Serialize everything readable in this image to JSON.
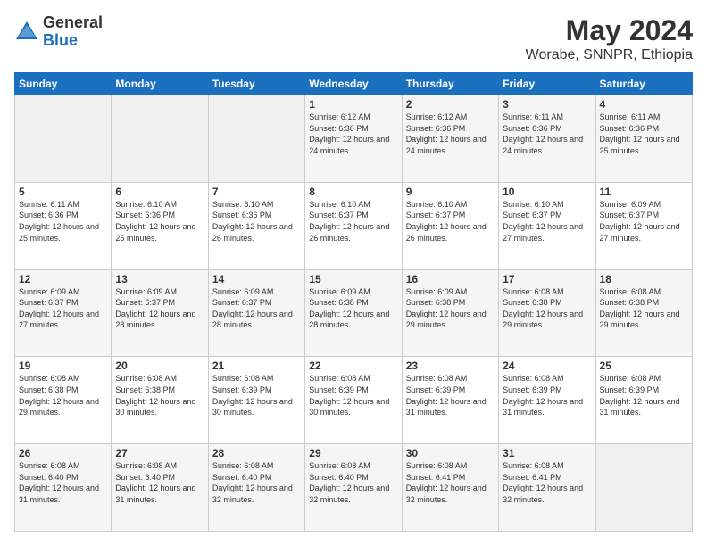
{
  "header": {
    "logo_general": "General",
    "logo_blue": "Blue",
    "month_year": "May 2024",
    "location": "Worabe, SNNPR, Ethiopia"
  },
  "weekdays": [
    "Sunday",
    "Monday",
    "Tuesday",
    "Wednesday",
    "Thursday",
    "Friday",
    "Saturday"
  ],
  "weeks": [
    [
      {
        "day": "",
        "info": ""
      },
      {
        "day": "",
        "info": ""
      },
      {
        "day": "",
        "info": ""
      },
      {
        "day": "1",
        "info": "Sunrise: 6:12 AM\nSunset: 6:36 PM\nDaylight: 12 hours and 24 minutes."
      },
      {
        "day": "2",
        "info": "Sunrise: 6:12 AM\nSunset: 6:36 PM\nDaylight: 12 hours and 24 minutes."
      },
      {
        "day": "3",
        "info": "Sunrise: 6:11 AM\nSunset: 6:36 PM\nDaylight: 12 hours and 24 minutes."
      },
      {
        "day": "4",
        "info": "Sunrise: 6:11 AM\nSunset: 6:36 PM\nDaylight: 12 hours and 25 minutes."
      }
    ],
    [
      {
        "day": "5",
        "info": "Sunrise: 6:11 AM\nSunset: 6:36 PM\nDaylight: 12 hours and 25 minutes."
      },
      {
        "day": "6",
        "info": "Sunrise: 6:10 AM\nSunset: 6:36 PM\nDaylight: 12 hours and 25 minutes."
      },
      {
        "day": "7",
        "info": "Sunrise: 6:10 AM\nSunset: 6:36 PM\nDaylight: 12 hours and 26 minutes."
      },
      {
        "day": "8",
        "info": "Sunrise: 6:10 AM\nSunset: 6:37 PM\nDaylight: 12 hours and 26 minutes."
      },
      {
        "day": "9",
        "info": "Sunrise: 6:10 AM\nSunset: 6:37 PM\nDaylight: 12 hours and 26 minutes."
      },
      {
        "day": "10",
        "info": "Sunrise: 6:10 AM\nSunset: 6:37 PM\nDaylight: 12 hours and 27 minutes."
      },
      {
        "day": "11",
        "info": "Sunrise: 6:09 AM\nSunset: 6:37 PM\nDaylight: 12 hours and 27 minutes."
      }
    ],
    [
      {
        "day": "12",
        "info": "Sunrise: 6:09 AM\nSunset: 6:37 PM\nDaylight: 12 hours and 27 minutes."
      },
      {
        "day": "13",
        "info": "Sunrise: 6:09 AM\nSunset: 6:37 PM\nDaylight: 12 hours and 28 minutes."
      },
      {
        "day": "14",
        "info": "Sunrise: 6:09 AM\nSunset: 6:37 PM\nDaylight: 12 hours and 28 minutes."
      },
      {
        "day": "15",
        "info": "Sunrise: 6:09 AM\nSunset: 6:38 PM\nDaylight: 12 hours and 28 minutes."
      },
      {
        "day": "16",
        "info": "Sunrise: 6:09 AM\nSunset: 6:38 PM\nDaylight: 12 hours and 29 minutes."
      },
      {
        "day": "17",
        "info": "Sunrise: 6:08 AM\nSunset: 6:38 PM\nDaylight: 12 hours and 29 minutes."
      },
      {
        "day": "18",
        "info": "Sunrise: 6:08 AM\nSunset: 6:38 PM\nDaylight: 12 hours and 29 minutes."
      }
    ],
    [
      {
        "day": "19",
        "info": "Sunrise: 6:08 AM\nSunset: 6:38 PM\nDaylight: 12 hours and 29 minutes."
      },
      {
        "day": "20",
        "info": "Sunrise: 6:08 AM\nSunset: 6:38 PM\nDaylight: 12 hours and 30 minutes."
      },
      {
        "day": "21",
        "info": "Sunrise: 6:08 AM\nSunset: 6:39 PM\nDaylight: 12 hours and 30 minutes."
      },
      {
        "day": "22",
        "info": "Sunrise: 6:08 AM\nSunset: 6:39 PM\nDaylight: 12 hours and 30 minutes."
      },
      {
        "day": "23",
        "info": "Sunrise: 6:08 AM\nSunset: 6:39 PM\nDaylight: 12 hours and 31 minutes."
      },
      {
        "day": "24",
        "info": "Sunrise: 6:08 AM\nSunset: 6:39 PM\nDaylight: 12 hours and 31 minutes."
      },
      {
        "day": "25",
        "info": "Sunrise: 6:08 AM\nSunset: 6:39 PM\nDaylight: 12 hours and 31 minutes."
      }
    ],
    [
      {
        "day": "26",
        "info": "Sunrise: 6:08 AM\nSunset: 6:40 PM\nDaylight: 12 hours and 31 minutes."
      },
      {
        "day": "27",
        "info": "Sunrise: 6:08 AM\nSunset: 6:40 PM\nDaylight: 12 hours and 31 minutes."
      },
      {
        "day": "28",
        "info": "Sunrise: 6:08 AM\nSunset: 6:40 PM\nDaylight: 12 hours and 32 minutes."
      },
      {
        "day": "29",
        "info": "Sunrise: 6:08 AM\nSunset: 6:40 PM\nDaylight: 12 hours and 32 minutes."
      },
      {
        "day": "30",
        "info": "Sunrise: 6:08 AM\nSunset: 6:41 PM\nDaylight: 12 hours and 32 minutes."
      },
      {
        "day": "31",
        "info": "Sunrise: 6:08 AM\nSunset: 6:41 PM\nDaylight: 12 hours and 32 minutes."
      },
      {
        "day": "",
        "info": ""
      }
    ]
  ]
}
